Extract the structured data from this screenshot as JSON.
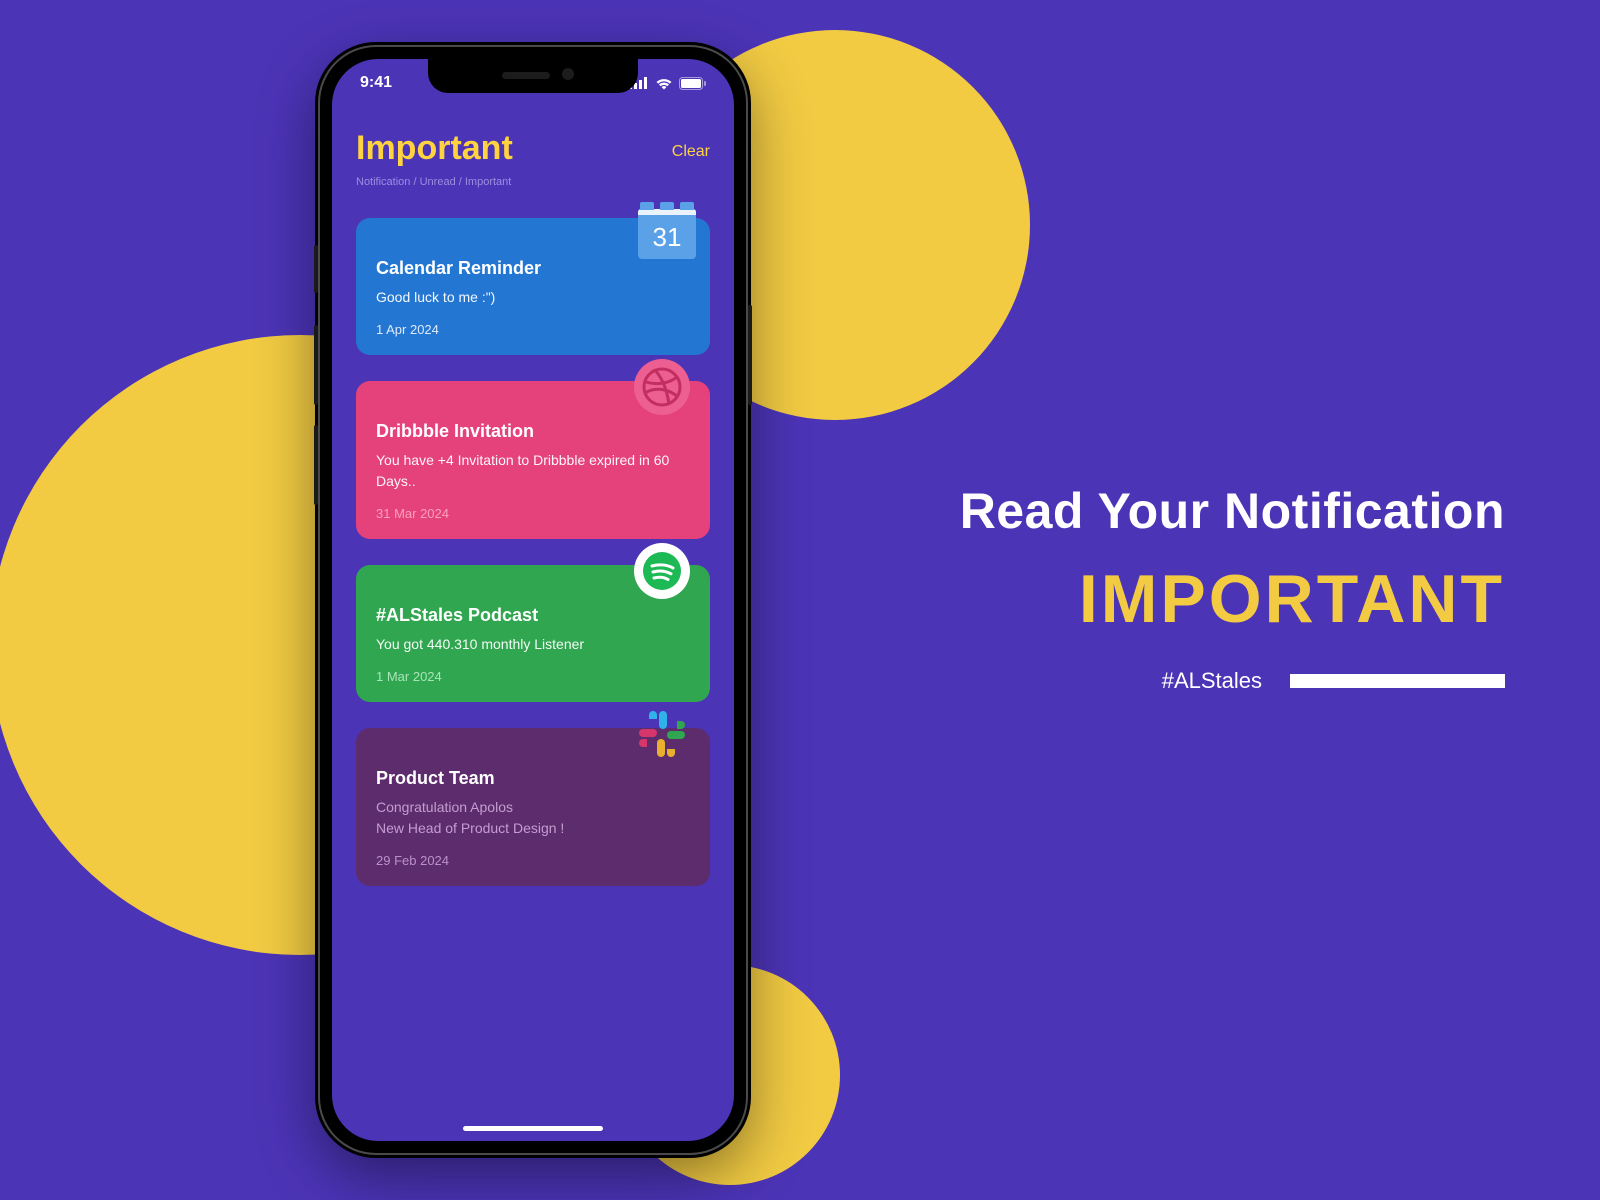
{
  "statusbar": {
    "time": "9:41"
  },
  "header": {
    "title": "Important",
    "clear": "Clear",
    "breadcrumb": [
      "Notification",
      "Unread",
      "Important"
    ]
  },
  "notifications": [
    {
      "icon": "calendar",
      "icon_value": "31",
      "title": "Calendar Reminder",
      "body": "Good luck to me :\")",
      "date": "1 Apr 2024",
      "color": "blue"
    },
    {
      "icon": "dribbble",
      "title": "Dribbble Invitation",
      "body": "You have +4 Invitation to Dribbble expired in 60 Days..",
      "date": "31 Mar 2024",
      "color": "pink"
    },
    {
      "icon": "spotify",
      "title": "#ALStales Podcast",
      "body": "You got 440.310 monthly Listener",
      "date": "1 Mar 2024",
      "color": "green"
    },
    {
      "icon": "slack",
      "title": "Product Team",
      "body": "Congratulation Apolos\nNew Head of Product Design !",
      "date": "29 Feb 2024",
      "color": "purple"
    }
  ],
  "promo": {
    "headline": "Read Your Notification",
    "keyword": "IMPORTANT",
    "hashtag": "#ALStales"
  }
}
